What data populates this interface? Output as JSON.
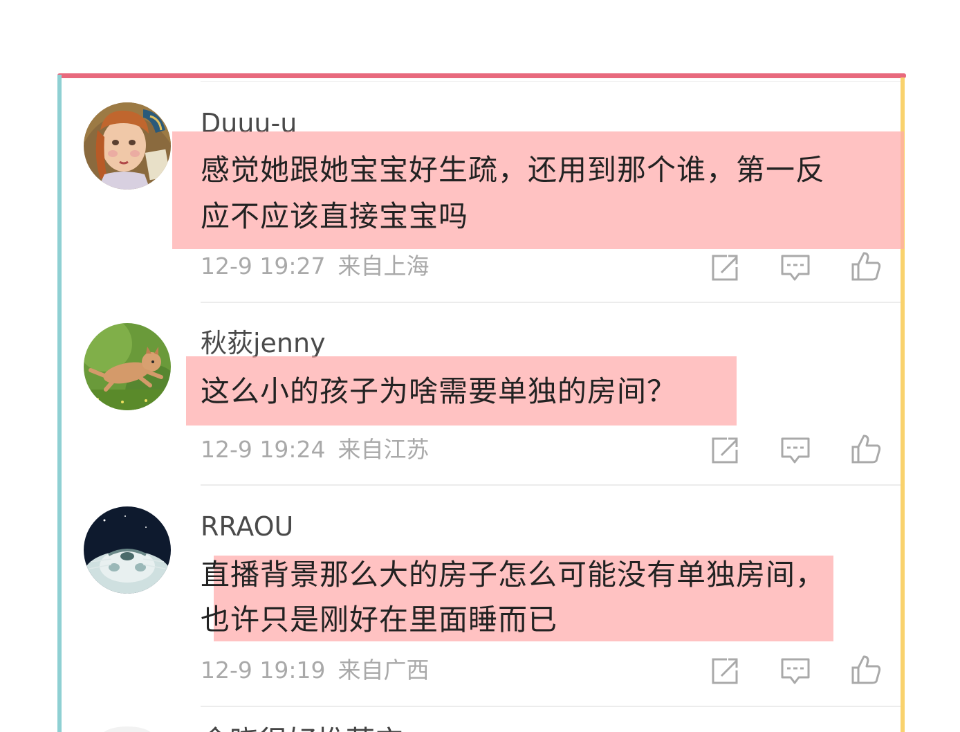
{
  "comments": [
    {
      "username": "Duuu-u",
      "text_lines": [
        "感觉她跟她宝宝好生疏，还用到那个谁，第一反",
        "应不应该直接宝宝吗"
      ],
      "time": "12-9 19:27",
      "location": "来自上海",
      "avatar": "girl-portrait-avatar"
    },
    {
      "username": "秋荻jenny",
      "text_lines": [
        "这么小的孩子为啥需要单独的房间？"
      ],
      "time": "12-9 19:24",
      "location": "来自江苏",
      "avatar": "kitten-avatar"
    },
    {
      "username": "RRAOU",
      "text_lines": [
        "直播背景那么大的房子怎么可能没有单独房间，",
        "也许只是刚好在里面睡而已"
      ],
      "time": "12-9 19:19",
      "location": "来自广西",
      "avatar": "cat-face-avatar"
    }
  ],
  "partial_next_comment": "余晓很好推荐它",
  "icons": {
    "share": "share-icon",
    "reply": "comment-icon",
    "like": "thumbs-up-icon"
  },
  "colors": {
    "frame_top": "#e8697d",
    "frame_left": "#8fd0d3",
    "frame_right": "#f9d26d",
    "highlight": "#ffaaaa",
    "meta_text": "#a9a9a9"
  }
}
